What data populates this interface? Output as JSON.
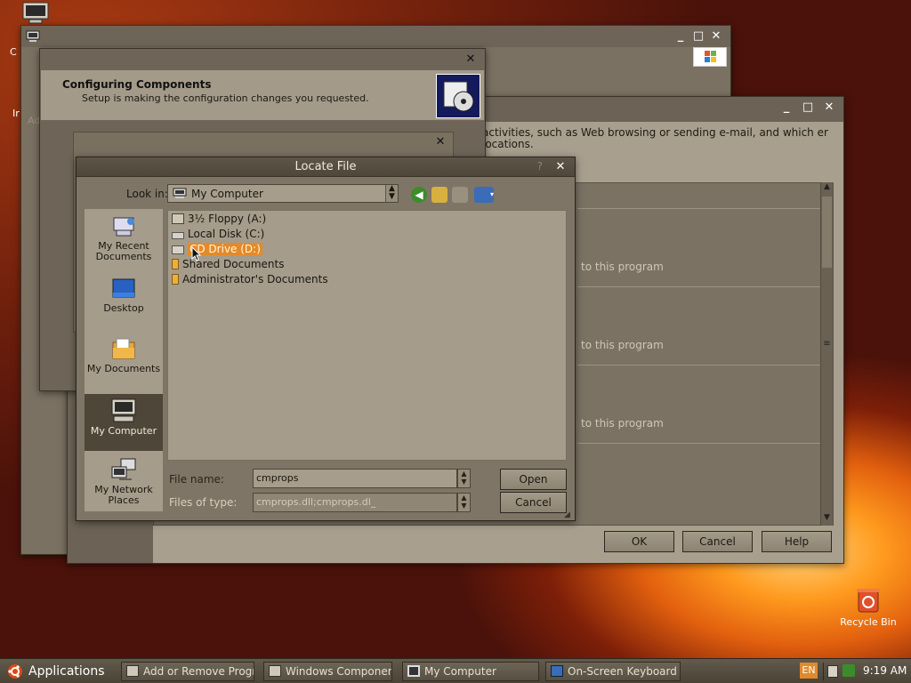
{
  "desktop": {
    "icon_top_left_label": "C",
    "recycle_bin_label": "Recycle Bin"
  },
  "window_computer": {
    "left_fragment_1": "Ir",
    "left_fragment_2": "Ad"
  },
  "window_components": {
    "description": "activities, such as Web browsing or sending e-mail, and which er locations.",
    "items": [
      {
        "label": "to this program"
      },
      {
        "label": "to this program"
      },
      {
        "label": "to this program"
      }
    ],
    "ok_label": "OK",
    "cancel_label": "Cancel",
    "help_label": "Help"
  },
  "window_config": {
    "title": "Configuring Components",
    "subtitle": "Setup is making the configuration changes you requested."
  },
  "locate_dialog": {
    "title": "Locate File",
    "help_glyph": "?",
    "look_in_label": "Look in:",
    "look_in_value": "My Computer",
    "places": [
      {
        "label": "My Recent Documents"
      },
      {
        "label": "Desktop"
      },
      {
        "label": "My Documents"
      },
      {
        "label": "My Computer"
      },
      {
        "label": "My Network Places"
      }
    ],
    "files": [
      {
        "label": "3½ Floppy (A:)"
      },
      {
        "label": "Local Disk (C:)"
      },
      {
        "label": "CD Drive (D:)"
      },
      {
        "label": "Shared Documents"
      },
      {
        "label": "Administrator's Documents"
      }
    ],
    "file_name_label": "File name:",
    "file_name_value": "cmprops",
    "files_of_type_label": "Files of type:",
    "files_of_type_value": "cmprops.dll;cmprops.dl_",
    "open_label": "Open",
    "cancel_label": "Cancel"
  },
  "taskbar": {
    "applications_label": "Applications",
    "tasks": [
      {
        "label": "Add or Remove Progr..."
      },
      {
        "label": "Windows Component..."
      },
      {
        "label": "My Computer"
      },
      {
        "label": "On-Screen Keyboard"
      }
    ],
    "language": "EN",
    "clock": "9:19 AM"
  },
  "colors": {
    "selection": "#e48a28",
    "window_frame": "#6e6558",
    "dialog_body": "#a59c8b"
  }
}
